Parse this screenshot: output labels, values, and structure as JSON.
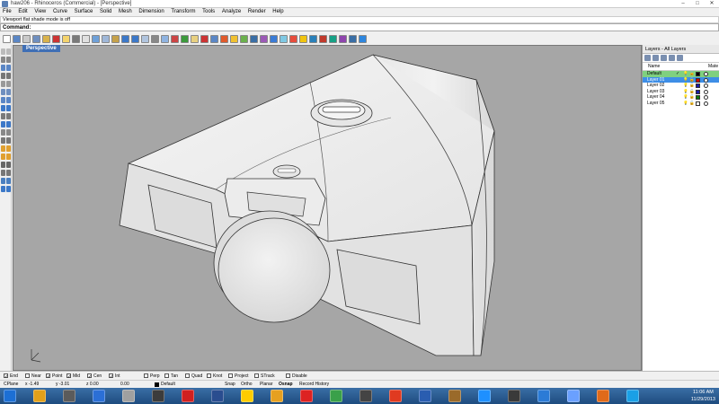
{
  "window": {
    "title": "haw206 - Rhinoceros (Commercial) - [Perspective]",
    "minimize": "–",
    "maximize": "□",
    "close": "✕"
  },
  "menu": [
    "File",
    "Edit",
    "View",
    "Curve",
    "Surface",
    "Solid",
    "Mesh",
    "Dimension",
    "Transform",
    "Tools",
    "Analyze",
    "Render",
    "Help"
  ],
  "command": {
    "history": "Viewport flat shade mode is off",
    "prompt": "Command:"
  },
  "viewport": {
    "tab": "Perspective"
  },
  "layers_panel": {
    "title": "Layers - All Layers",
    "columns": {
      "name": "Name",
      "material": "Mate"
    },
    "rows": [
      {
        "name": "Default",
        "check": "✓",
        "color": "#000000",
        "bg": "#7fd07f"
      },
      {
        "name": "Layer 01",
        "check": "",
        "color": "#cc0000",
        "bg": "#3e8ee6"
      },
      {
        "name": "Layer 02",
        "check": "",
        "color": "#1a1aa6",
        "bg": "#ffffff"
      },
      {
        "name": "Layer 03",
        "check": "",
        "color": "#1a1aa6",
        "bg": "#ffffff"
      },
      {
        "name": "Layer 04",
        "check": "",
        "color": "#0a7a0a",
        "bg": "#ffffff"
      },
      {
        "name": "Layer 05",
        "check": "",
        "color": "#ffffff",
        "bg": "#ffffff"
      }
    ]
  },
  "osnap": [
    {
      "label": "End",
      "checked": true
    },
    {
      "label": "Near",
      "checked": false
    },
    {
      "label": "Point",
      "checked": true
    },
    {
      "label": "Mid",
      "checked": true
    },
    {
      "label": "Cen",
      "checked": true
    },
    {
      "label": "Int",
      "checked": true
    },
    {
      "label": "Perp",
      "checked": false
    },
    {
      "label": "Tan",
      "checked": false
    },
    {
      "label": "Quad",
      "checked": false
    },
    {
      "label": "Knot",
      "checked": false
    },
    {
      "label": "Project",
      "checked": false
    },
    {
      "label": "STrack",
      "checked": false
    },
    {
      "label": "Disable",
      "checked": false
    }
  ],
  "status": {
    "cplane": "CPlane",
    "x": "x -1.49",
    "y": "y -3.01",
    "z": "z 0.00",
    "value": "0.00",
    "layer": "Default",
    "snap": "Snap",
    "ortho": "Ortho",
    "planar": "Planar",
    "osnap": "Osnap",
    "record_history": "Record History"
  },
  "clock": {
    "time": "11:06 AM",
    "date": "11/29/2013"
  },
  "icons": {
    "toolbar_colors": [
      "#ffffff",
      "#5a86c5",
      "#c9c9c9",
      "#6f8fbf",
      "#d9b24c",
      "#cc3333",
      "#f4d36c",
      "#7a7a7a",
      "#e0e0e0",
      "#6ea0d8",
      "#9fb7d8",
      "#c5a14a",
      "#3c78c8",
      "#3c78c8",
      "#b0c4de",
      "#888888",
      "#8fb3e0",
      "#c44",
      "#3c9a3c",
      "#e8d080",
      "#c33",
      "#5a86c5",
      "#e05a2b",
      "#f0c030",
      "#6ab04c",
      "#3a6ea5",
      "#9b59b6",
      "#3a7bd5",
      "#7ec8e3",
      "#e74c3c",
      "#f1c40f",
      "#2980b9",
      "#c0392b",
      "#16a085",
      "#8e44ad",
      "#3a6ea5",
      "#2e86de"
    ],
    "taskbar_colors": [
      "#1c6fd4",
      "#e2a01a",
      "#5b5b5b",
      "#2b6fd6",
      "#a0a0a0",
      "#3c3c3c",
      "#d02020",
      "#2a4d8f",
      "#ffcc00",
      "#e6a020",
      "#dd2222",
      "#3aa04a",
      "#444444",
      "#e03a20",
      "#2a5db0",
      "#9a6a2a",
      "#1e90ff",
      "#3a3a3a",
      "#2b7bd6",
      "#6aa0ff",
      "#e06a1a",
      "#1aa0e6"
    ]
  }
}
